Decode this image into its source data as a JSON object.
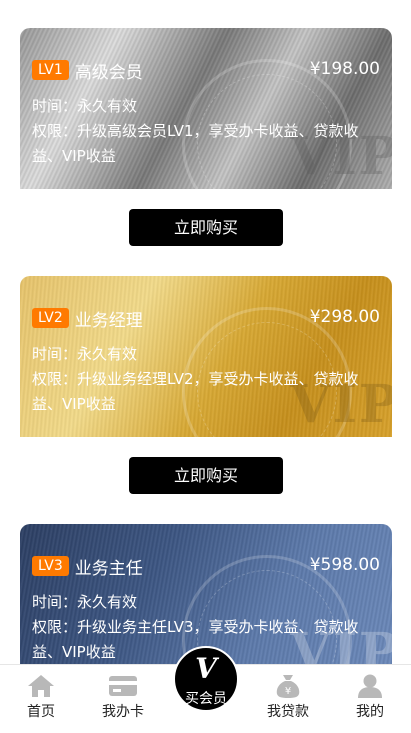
{
  "cards": [
    {
      "badge": "LV1",
      "name": "高级会员",
      "price": "¥198.00",
      "validity": "时间：永久有效",
      "rights": "权限：升级高级会员LV1，享受办卡收益、贷款收益、VIP收益",
      "watermark": "VIP",
      "button": "立即购买"
    },
    {
      "badge": "LV2",
      "name": "业务经理",
      "price": "¥298.00",
      "validity": "时间：永久有效",
      "rights": "权限：升级业务经理LV2，享受办卡收益、贷款收益、VIP收益",
      "watermark": "VIP",
      "button": "立即购买"
    },
    {
      "badge": "LV3",
      "name": "业务主任",
      "price": "¥598.00",
      "validity": "时间：永久有效",
      "rights": "权限：升级业务主任LV3，享受办卡收益、贷款收益、VIP收益",
      "watermark": "VIP"
    }
  ],
  "tabbar": {
    "home": "首页",
    "card": "我办卡",
    "center_icon": "V",
    "center": "买会员",
    "loan": "我贷款",
    "mine": "我的"
  },
  "colors": {
    "badge": "#ff7a00",
    "button": "#000000",
    "icon": "#b8b8b8"
  },
  "icons": [
    "home-icon",
    "card-icon",
    "v-icon",
    "yen-bag-icon",
    "user-icon"
  ]
}
